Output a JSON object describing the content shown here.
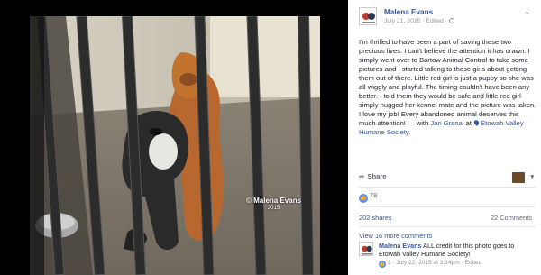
{
  "photo": {
    "watermark": "© Malena Evans",
    "watermark_year": "2015"
  },
  "post": {
    "author": "Malena Evans",
    "date": "July 21, 2015",
    "edited": "Edited",
    "separator": "·",
    "text": "I'm thrilled to have been a part of saving these two precious lives. I can't believe the attention it has drawn. I simply went over to Bartow Animal Control to take some pictures and I started talking to these girls about getting them out of there. Little red girl is just a puppy so she was all wiggly and playful. The timing couldn't have been any better. I told them they would be safe and little red girl simply hugged her kennel mate and the picture was taken. I love my job! Every abandoned animal deserves this much attention!",
    "with_prefix": " — with ",
    "tagged_person": "Jan Granai",
    "at_word": " at ",
    "location": "Etowah Valley Humane Society",
    "period": "."
  },
  "actions": {
    "share_label": "Share",
    "share_icon": "share-arrow-icon"
  },
  "reactions": {
    "like_count": "78"
  },
  "stats": {
    "shares": "202 shares",
    "comments": "22 Comments"
  },
  "comments": {
    "view_more": "View 16 more comments",
    "items": [
      {
        "author": "Malena Evans",
        "text": " ALL credit for this photo goes to Etowah Valley Humane Society!",
        "likes": "1",
        "date": "July 22, 2015 at 3:14pm",
        "edited": "Edited"
      }
    ]
  },
  "colors": {
    "link": "#365899",
    "muted": "#90949c",
    "like_blue": "#5890ff"
  }
}
